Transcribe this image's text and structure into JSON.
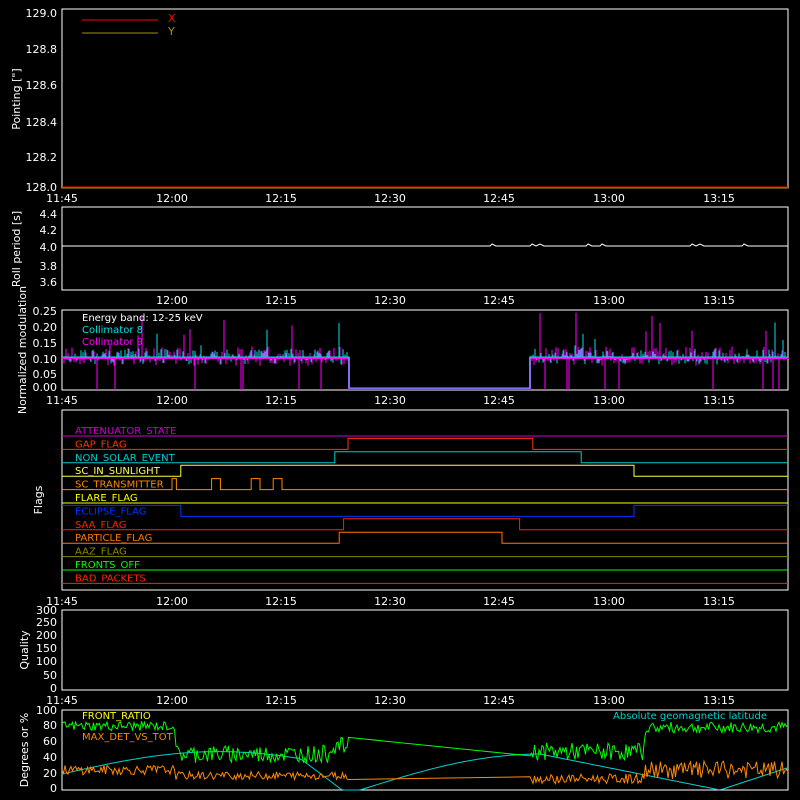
{
  "colors": {
    "background": "#000000",
    "axes": "#ffffff",
    "x": "#ff0000",
    "y": "#999900",
    "roll": "#ffffff",
    "collimator8": "#00e0e0",
    "collimator9": "#ff00ff",
    "front_ratio": "#00ff00",
    "max_det": "#ff8800",
    "latitude": "#00d0d0"
  },
  "chart_data": [
    {
      "id": "pointing",
      "type": "line",
      "ylabel": "Pointing [\"]",
      "x_ticks": [
        "11:45",
        "12:00",
        "12:15",
        "12:30",
        "12:45",
        "13:00",
        "13:15"
      ],
      "ylim": [
        128.0,
        129.0
      ],
      "y_ticks": [
        "128.0",
        "128.2",
        "128.4",
        "128.6",
        "128.8",
        "129.0"
      ],
      "series": [
        {
          "name": "X",
          "values": [
            128.0,
            128.0
          ]
        },
        {
          "name": "Y",
          "values": [
            128.0,
            128.0
          ]
        }
      ]
    },
    {
      "id": "roll",
      "type": "line",
      "ylabel": "Roll period [s]",
      "x_ticks": [
        "12:00",
        "12:15",
        "12:30",
        "12:45",
        "13:00",
        "13:15"
      ],
      "ylim": [
        3.5,
        4.5
      ],
      "y_ticks": [
        "3.6",
        "3.8",
        "4.0",
        "4.2",
        "4.4"
      ],
      "values": [
        4.0,
        4.0,
        4.0,
        4.0,
        4.0,
        4.0,
        4.0,
        4.0,
        4.0,
        4.0
      ]
    },
    {
      "id": "modulation",
      "type": "line",
      "ylabel": "Normalized modulation",
      "x_ticks": [
        "11:45",
        "12:00",
        "12:15",
        "12:30",
        "12:45",
        "13:00",
        "13:15"
      ],
      "ylim": [
        0.0,
        0.25
      ],
      "y_ticks": [
        "0.00",
        "0.05",
        "0.10",
        "0.15",
        "0.20",
        "0.25"
      ],
      "annotation": "Energy band: 12-25 keV",
      "series": [
        {
          "name": "Collimator 8",
          "values": [
            0.1,
            0.1
          ]
        },
        {
          "name": "Collimator 9",
          "values": [
            0.1,
            0.1
          ]
        }
      ]
    },
    {
      "id": "flags",
      "type": "line",
      "ylabel": "Flags",
      "x_ticks": [
        "11:45",
        "12:00",
        "12:15",
        "12:30",
        "12:45",
        "13:00",
        "13:15"
      ],
      "flags": [
        {
          "name": "ATTENUATOR_STATE",
          "color": "#cc00cc",
          "steps": []
        },
        {
          "name": "GAP_FLAG",
          "color": "#ff3300",
          "steps": [
            [
              12.4,
              12.82
            ]
          ]
        },
        {
          "name": "NON_SOLAR_EVENT",
          "color": "#00cccc",
          "steps": [
            [
              12.37,
              12.93
            ]
          ]
        },
        {
          "name": "SC_IN_SUNLIGHT",
          "color": "#ffff44",
          "steps": [
            [
              12.02,
              13.05
            ]
          ]
        },
        {
          "name": "SC_TRANSMITTER",
          "color": "#ff8800",
          "steps": [
            [
              12.0,
              12.01
            ],
            [
              12.09,
              12.11
            ],
            [
              12.18,
              12.2
            ],
            [
              12.23,
              12.25
            ]
          ]
        },
        {
          "name": "FLARE_FLAG",
          "color": "#ffff00",
          "steps": []
        },
        {
          "name": "ECLIPSE_FLAG",
          "color": "#0033ff",
          "steps": [
            [
              11.5,
              12.02
            ],
            [
              13.05,
              14.0
            ]
          ]
        },
        {
          "name": "SAA_FLAG",
          "color": "#ff2200",
          "steps": [
            [
              12.39,
              12.79
            ]
          ]
        },
        {
          "name": "PARTICLE_FLAG",
          "color": "#ff7700",
          "steps": [
            [
              12.38,
              12.75
            ]
          ]
        },
        {
          "name": "AAZ_FLAG",
          "color": "#888800",
          "steps": []
        },
        {
          "name": "FRONTS_OFF",
          "color": "#00ff00",
          "steps": []
        },
        {
          "name": "BAD_PACKETS",
          "color": "#ff2200",
          "steps": []
        }
      ]
    },
    {
      "id": "quality",
      "type": "line",
      "ylabel": "Quality",
      "x_ticks": [
        "11:45",
        "12:00",
        "12:15",
        "12:30",
        "12:45",
        "13:00",
        "13:15"
      ],
      "ylim": [
        0,
        300
      ],
      "y_ticks": [
        "0",
        "50",
        "100",
        "150",
        "200",
        "250",
        "300"
      ],
      "values": []
    },
    {
      "id": "ratios",
      "type": "line",
      "ylabel": "Degrees or %",
      "ylim": [
        0,
        100
      ],
      "y_ticks": [
        "0",
        "20",
        "40",
        "60",
        "80",
        "100"
      ],
      "series": [
        {
          "name": "FRONT_RATIO",
          "values": [
            80,
            80,
            50,
            50,
            0,
            0,
            50,
            50,
            80,
            80
          ]
        },
        {
          "name": "MAX_DET_VS_TOT",
          "values": [
            25,
            25,
            18,
            18,
            0,
            0,
            15,
            15,
            25,
            25
          ]
        },
        {
          "name": "Absolute geomagnetic latitude",
          "values": [
            22,
            35,
            45,
            30,
            0,
            30,
            45,
            30,
            0,
            20,
            30
          ]
        }
      ]
    }
  ]
}
